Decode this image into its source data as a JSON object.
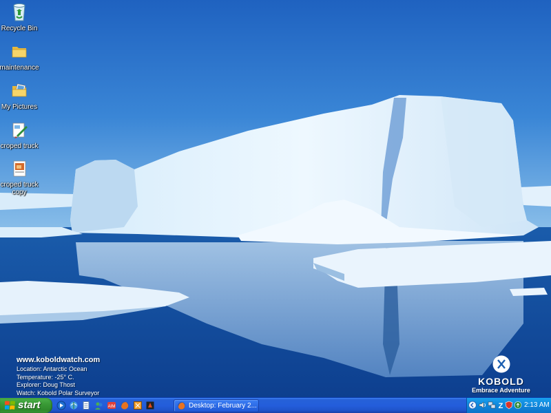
{
  "desktop": {
    "icons": [
      {
        "label": "Recycle Bin",
        "icon": "recycle-bin-icon"
      },
      {
        "label": "maintenance",
        "icon": "folder-icon"
      },
      {
        "label": "My Pictures",
        "icon": "my-pictures-folder-icon"
      },
      {
        "label": "croped truck",
        "icon": "paint-image-icon"
      },
      {
        "label": "croped truck copy",
        "icon": "image-file-icon"
      }
    ]
  },
  "wallpaper": {
    "info": {
      "site": "www.koboldwatch.com",
      "location": "Location: Antarctic Ocean",
      "temperature": "Temperature: -25° C.",
      "explorer": "Explorer: Doug Thost",
      "watch": "Watch: Kobold Polar Surveyor"
    },
    "brand": {
      "name": "KOBOLD",
      "tagline": "Embrace Adventure"
    }
  },
  "taskbar": {
    "start_label": "start",
    "quick_launch": [
      "media-player-icon",
      "network-icon",
      "notepad-icon",
      "msn-icon",
      "aim-icon",
      "firefox-icon",
      "winamp-icon",
      "app-icon"
    ],
    "tasks": [
      {
        "label": "Desktop: February 2...",
        "icon": "firefox-icon"
      }
    ],
    "tray": {
      "icons": [
        "arrow-left-icon",
        "speaker-icon",
        "network-status-icon",
        "z-icon",
        "security-icon",
        "update-icon"
      ],
      "clock": "2:13 AM"
    }
  },
  "colors": {
    "taskbar_blue": "#245edb",
    "start_green": "#3a9a36",
    "tray_blue": "#0f86db",
    "sky": "#2f78c9"
  }
}
